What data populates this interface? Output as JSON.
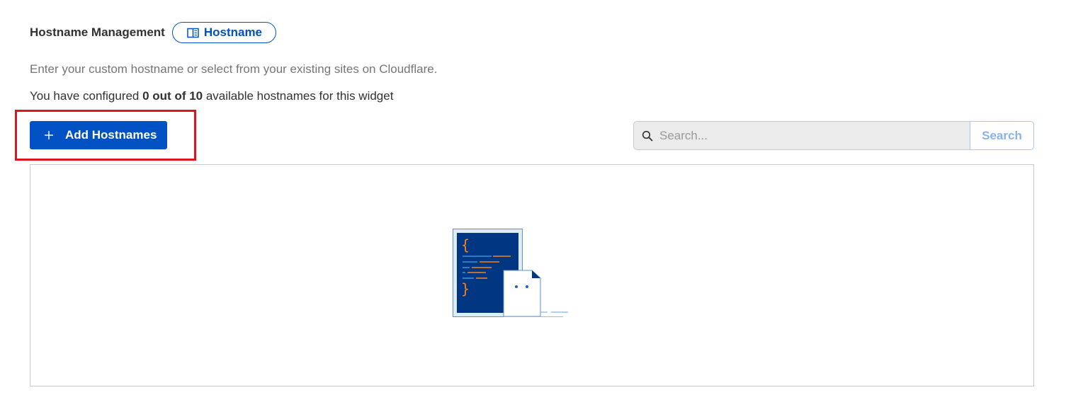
{
  "header": {
    "title": "Hostname Management",
    "docs_link_label": "Hostname"
  },
  "description": "Enter your custom hostname or select from your existing sites on Cloudflare.",
  "usage": {
    "prefix": "You have configured ",
    "count_text": "0 out of 10",
    "suffix": " available hostnames for this widget"
  },
  "toolbar": {
    "add_button_label": "Add Hostnames",
    "search_placeholder": "Search...",
    "search_value": "",
    "search_button_label": "Search"
  },
  "icons": {
    "docs": "book-icon",
    "add": "plus-icon",
    "search": "search-icon",
    "empty": "empty-state-illustration"
  },
  "colors": {
    "primary": "#0051c3",
    "highlight": "#e0141b",
    "search_button_text": "#8ab2ea",
    "illustration_dark": "#003682",
    "illustration_accent": "#f6821f"
  }
}
